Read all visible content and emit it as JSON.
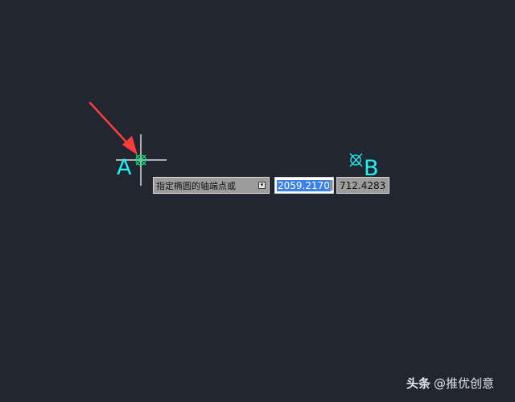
{
  "drawing_area": {
    "background_color": "#212630",
    "point_a_label": "A",
    "point_b_label": "B",
    "crosshair_color": "#ffffff",
    "snap_marker_color": "#00e676",
    "point_label_color": "#1ef2f5",
    "arrow_color": "#ff3b3b"
  },
  "dynamic_input": {
    "prompt": "指定椭圆的轴端点或",
    "dropdown_icon": "dropdown-arrow-icon",
    "x_value": "2059.2170",
    "y_value": "712.4283"
  },
  "watermark": {
    "brand": "头条",
    "author": "@推优创意"
  }
}
